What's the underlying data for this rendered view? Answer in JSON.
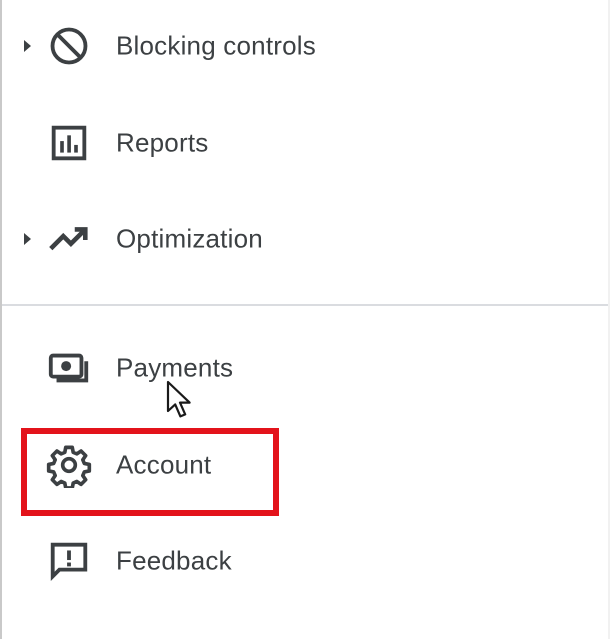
{
  "nav": {
    "items": [
      {
        "label": "Blocking controls",
        "icon": "block-icon",
        "expandable": true
      },
      {
        "label": "Reports",
        "icon": "bar-chart-icon",
        "expandable": false
      },
      {
        "label": "Optimization",
        "icon": "trending-up-icon",
        "expandable": true
      },
      {
        "label": "Payments",
        "icon": "payments-icon",
        "expandable": false
      },
      {
        "label": "Account",
        "icon": "gear-icon",
        "expandable": false,
        "highlighted": true
      },
      {
        "label": "Feedback",
        "icon": "feedback-icon",
        "expandable": false
      }
    ]
  },
  "colors": {
    "text": "#3c4043",
    "icon": "#3c4043",
    "divider": "#dadce0",
    "highlight": "#e3131b"
  }
}
